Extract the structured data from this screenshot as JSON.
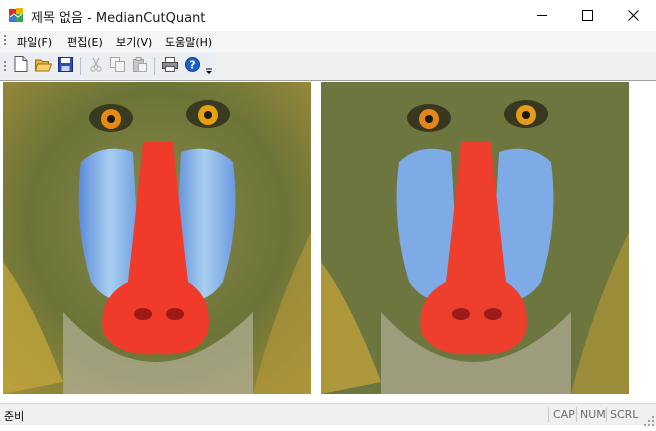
{
  "window": {
    "title": "제목 없음 - MedianCutQuant",
    "app_icon": "mfc-app-icon"
  },
  "caption_buttons": {
    "minimize": "minimize-icon",
    "maximize": "maximize-icon",
    "close": "close-icon"
  },
  "menu": {
    "items": [
      {
        "label": "파일(F)"
      },
      {
        "label": "편집(E)"
      },
      {
        "label": "보기(V)"
      },
      {
        "label": "도움말(H)"
      }
    ]
  },
  "toolbar": {
    "buttons": [
      {
        "icon": "new-document-icon",
        "enabled": true
      },
      {
        "icon": "open-folder-icon",
        "enabled": true
      },
      {
        "icon": "save-icon",
        "enabled": true
      },
      {
        "icon": "cut-icon",
        "enabled": false
      },
      {
        "icon": "copy-icon",
        "enabled": false
      },
      {
        "icon": "paste-icon",
        "enabled": false
      },
      {
        "icon": "print-icon",
        "enabled": true
      },
      {
        "icon": "help-icon",
        "enabled": true
      }
    ],
    "overflow_icon": "toolbar-overflow-icon"
  },
  "content": {
    "left_image": "mandrill-original",
    "right_image": "mandrill-quantized"
  },
  "statusbar": {
    "text": "준비",
    "indicators": [
      "CAP",
      "NUM",
      "SCRL"
    ]
  },
  "colors": {
    "titlebar_bg": "#ffffff",
    "menubar_bg": "#f5f6f7",
    "toolbar_bg": "#eaeef3",
    "client_bg": "#ffffff",
    "statusbar_bg": "#f0f0f0",
    "indicator_text": "#6d6d6d"
  }
}
